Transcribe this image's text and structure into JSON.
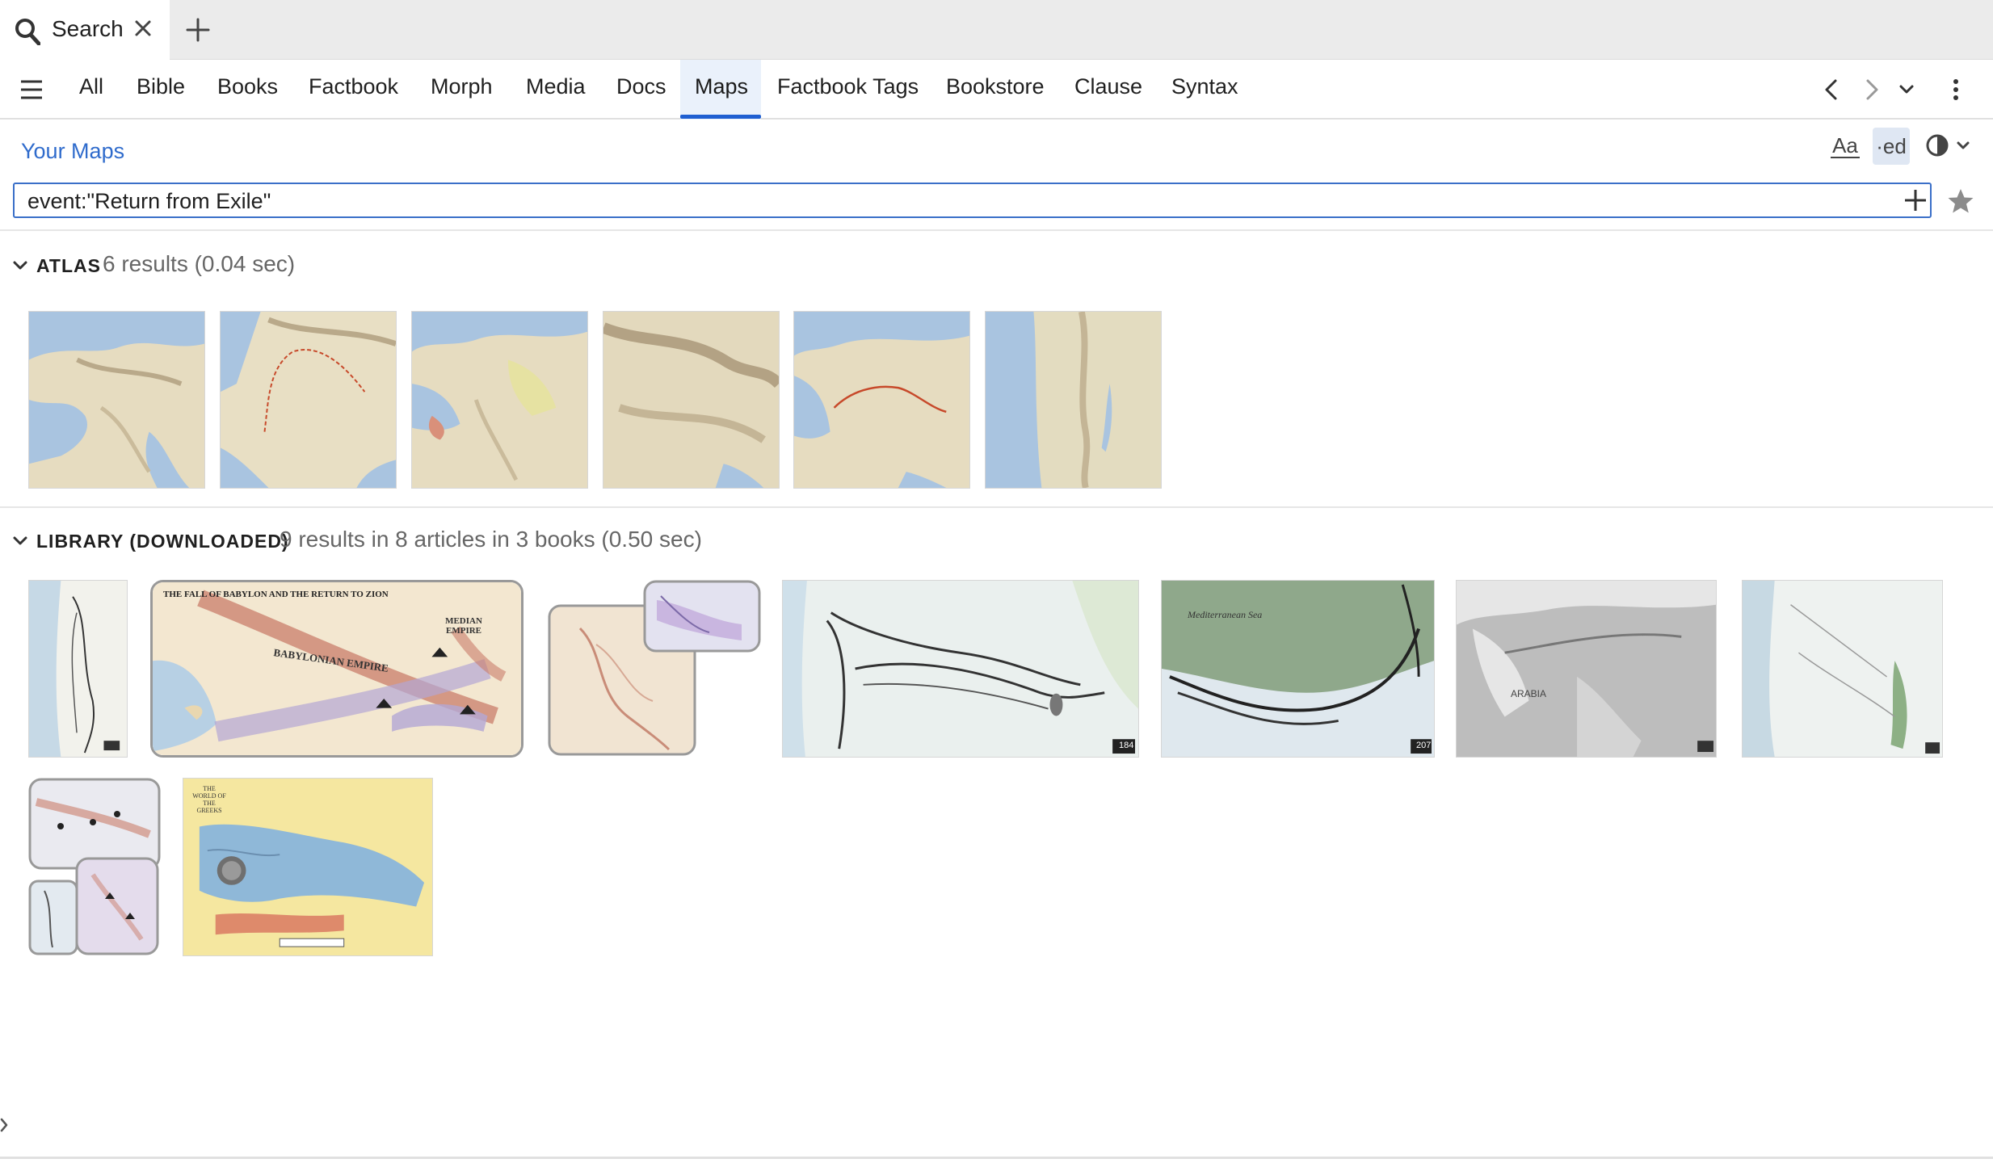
{
  "tab": {
    "title": "Search",
    "icon": "search-icon",
    "close_icon": "close-icon",
    "add_icon": "plus-icon"
  },
  "nav": {
    "menu_icon": "hamburger-icon",
    "tabs": [
      "All",
      "Bible",
      "Books",
      "Factbook",
      "Morph",
      "Media",
      "Docs",
      "Maps",
      "Factbook Tags",
      "Bookstore",
      "Clause",
      "Syntax"
    ],
    "active_tab": "Maps",
    "accent_color": "#1f5fd1"
  },
  "header": {
    "your_maps_label": "Your Maps",
    "font_icon_label": "Aa",
    "ed_icon_label": "·ed"
  },
  "search": {
    "query": "event:\"Return from Exile\""
  },
  "atlas": {
    "title": "ATLAS",
    "meta": "6 results (0.04 sec)",
    "thumbnail_count": 6
  },
  "library": {
    "title": "LIBRARY (DOWNLOADED)",
    "meta": "9 results in 8 articles in 3 books (0.50 sec)",
    "thumbnail_count": 9,
    "map_captions": {
      "babylon_title": "THE FALL OF BABYLON AND THE RETURN TO ZION",
      "babylon_empire": "BABYLONIAN EMPIRE",
      "median_empire": "MEDIAN EMPIRE",
      "greeks_title": "THE WORLD OF THE GREEKS",
      "med_sea": "Mediterranean Sea",
      "arabia": "ARABIA",
      "page_184": "184",
      "page_207": "207"
    }
  },
  "colors": {
    "link": "#2f6bcc",
    "search_border": "#3a6fc8",
    "meta_text": "#666666"
  }
}
